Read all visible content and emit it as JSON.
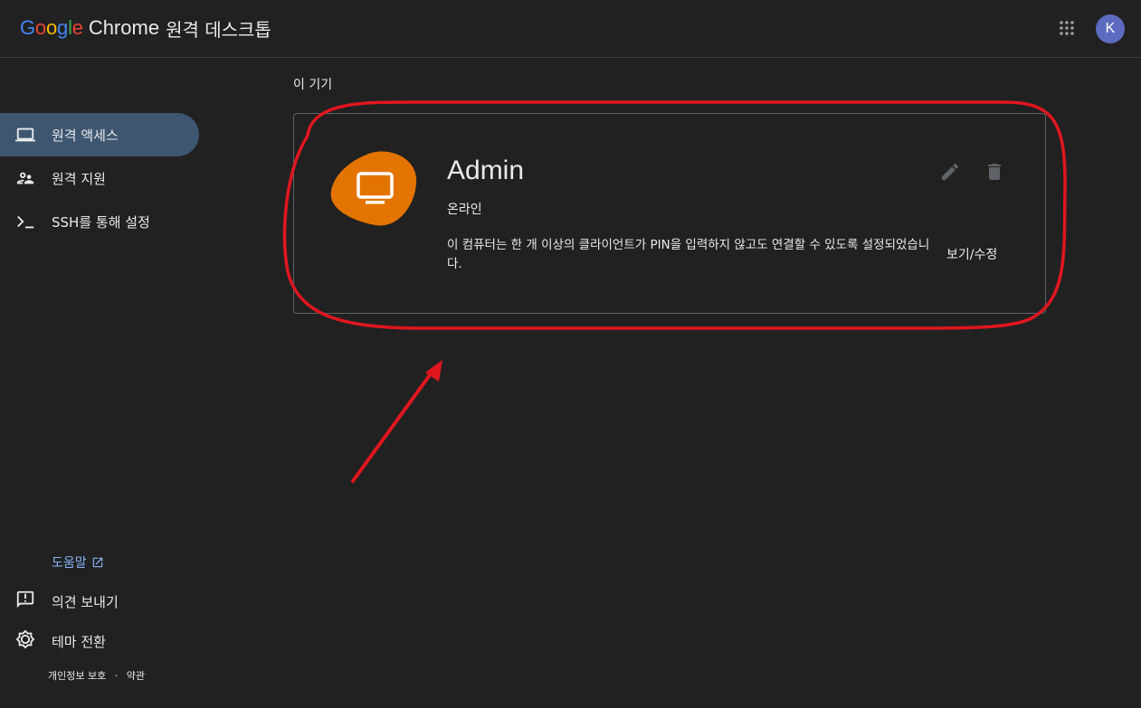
{
  "header": {
    "brand": {
      "google_letters": [
        {
          "ch": "G",
          "color": "#4285F4"
        },
        {
          "ch": "o",
          "color": "#EA4335"
        },
        {
          "ch": "o",
          "color": "#FBBC05"
        },
        {
          "ch": "g",
          "color": "#4285F4"
        },
        {
          "ch": "l",
          "color": "#34A853"
        },
        {
          "ch": "e",
          "color": "#EA4335"
        }
      ],
      "chrome": "Chrome",
      "product": "원격 데스크톱"
    },
    "apps_icon": "apps-grid-icon",
    "avatar_initial": "K",
    "avatar_color": "#5c6bc0"
  },
  "sidebar": {
    "items": [
      {
        "label": "원격 액세스",
        "icon": "laptop-icon",
        "active": true
      },
      {
        "label": "원격 지원",
        "icon": "people-icon",
        "active": false
      },
      {
        "label": "SSH를 통해 설정",
        "icon": "terminal-icon",
        "active": false
      }
    ],
    "help": "도움말",
    "feedback": "의견 보내기",
    "theme": "테마 전환",
    "privacy": "개인정보 보호",
    "separator": "·",
    "terms": "약관"
  },
  "main": {
    "section_title": "이 기기",
    "device": {
      "name": "Admin",
      "status": "온라인",
      "description": "이 컴퓨터는 한 개 이상의 클라이언트가 PIN을 입력하지 않고도 연결할 수 있도록 설정되었습니다.",
      "view_edit": "보기/수정",
      "icon": "monitor-icon",
      "accent": "#e37400"
    }
  },
  "annotation": {
    "color": "#e0161f"
  }
}
